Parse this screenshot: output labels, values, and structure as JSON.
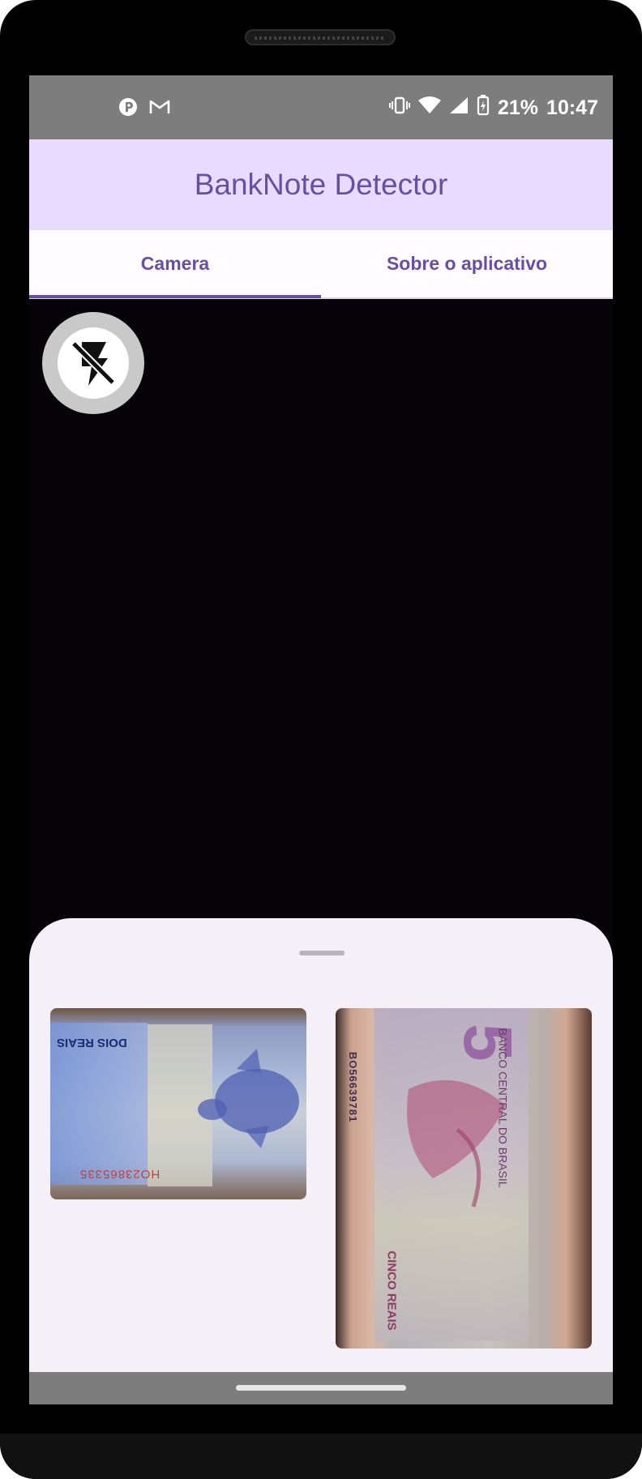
{
  "status_bar": {
    "battery": "21%",
    "time": "10:47",
    "left_icons": [
      "notification-app-icon",
      "gmail-icon"
    ],
    "right_icons": [
      "vibrate-icon",
      "wifi-icon",
      "cell-signal-icon",
      "battery-charging-icon"
    ]
  },
  "app_bar": {
    "title": "BankNote Detector"
  },
  "tabs": [
    {
      "label": "Camera",
      "selected": true
    },
    {
      "label": "Sobre o aplicativo",
      "selected": false
    }
  ],
  "flash": {
    "icon": "flash-off-icon"
  },
  "samples": [
    {
      "name": "DOIS REAIS",
      "serial": "HO23865335"
    },
    {
      "name": "CINCO REAIS",
      "bank": "BANCO CENTRAL DO BRASIL",
      "serial": "BO56639781"
    }
  ],
  "colors": {
    "accent": "#6650a4",
    "app_bar": "#e9dbff",
    "sheet": "#f5eff8",
    "status_bar": "#7d7d7d"
  }
}
